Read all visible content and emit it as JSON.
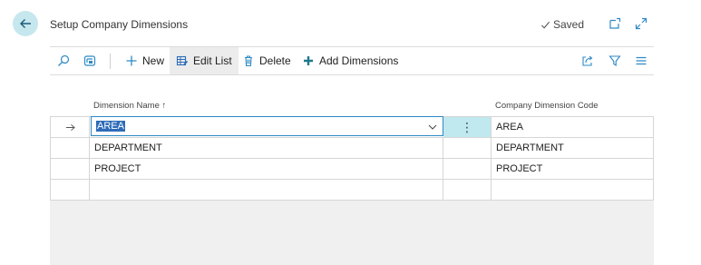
{
  "header": {
    "title": "Setup Company Dimensions",
    "status": "Saved"
  },
  "actions": {
    "new": "New",
    "edit_list": "Edit List",
    "delete": "Delete",
    "add_dimensions": "Add Dimensions"
  },
  "grid": {
    "columns": {
      "dimension_name": "Dimension Name",
      "dimension_sort_indicator": "↑",
      "company_dimension_code": "Company Dimension Code"
    },
    "rows": [
      {
        "dimension_name": "AREA",
        "company_dimension_code": "AREA"
      },
      {
        "dimension_name": "DEPARTMENT",
        "company_dimension_code": "DEPARTMENT"
      },
      {
        "dimension_name": "PROJECT",
        "company_dimension_code": "PROJECT"
      },
      {
        "dimension_name": "",
        "company_dimension_code": ""
      }
    ]
  },
  "colors": {
    "accent": "#2e8ac6",
    "back_button_bg": "#c7e7ee",
    "selection": "#2e6cb8",
    "active_menu_cell": "#bfe8ef"
  },
  "icons": [
    "back-arrow-icon",
    "checkmark-icon",
    "pop-out-icon",
    "expand-icon",
    "search-icon",
    "personalize-icon",
    "plus-icon",
    "edit-list-icon",
    "trash-icon",
    "add-dimensions-icon",
    "share-icon",
    "filter-icon",
    "list-view-icon",
    "row-arrow-icon",
    "chevron-down-icon",
    "kebab-menu-icon"
  ]
}
